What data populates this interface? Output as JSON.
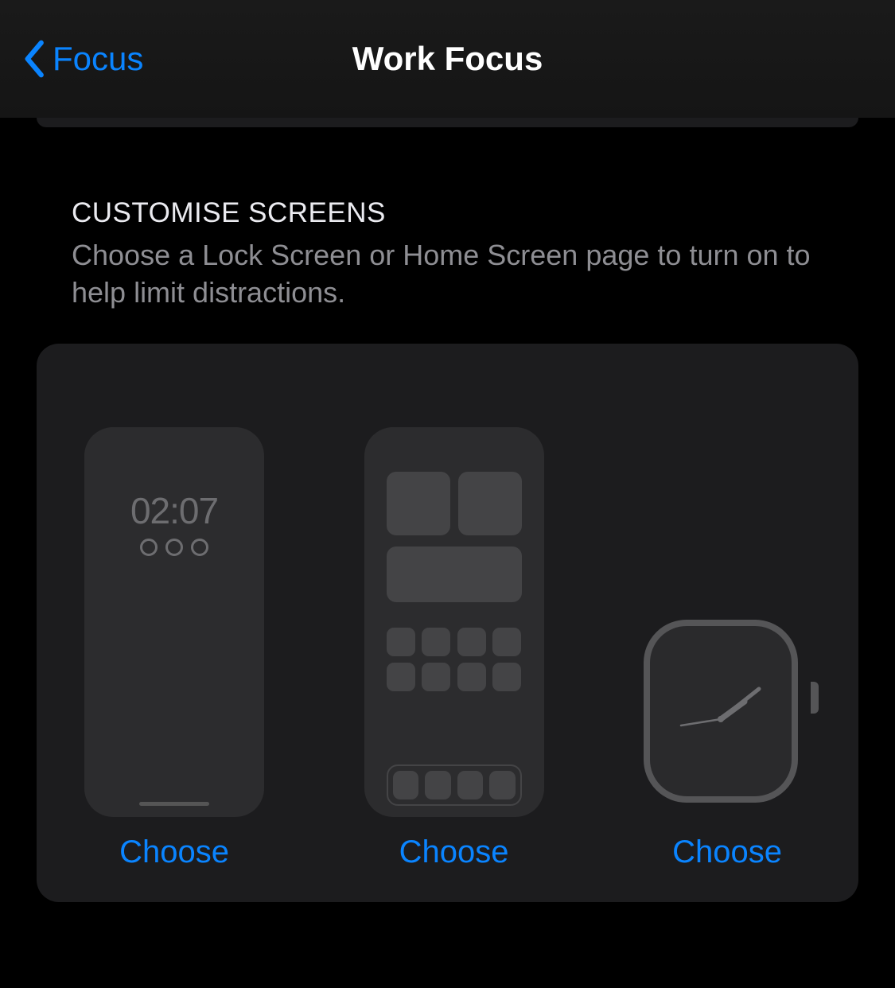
{
  "nav": {
    "back_label": "Focus",
    "title": "Work Focus"
  },
  "section": {
    "title": "CUSTOMISE SCREENS",
    "description": "Choose a Lock Screen or Home Screen page to turn on to help limit distractions."
  },
  "screens": {
    "lock": {
      "time": "02:07",
      "choose_label": "Choose"
    },
    "home": {
      "choose_label": "Choose"
    },
    "watch": {
      "choose_label": "Choose"
    }
  }
}
